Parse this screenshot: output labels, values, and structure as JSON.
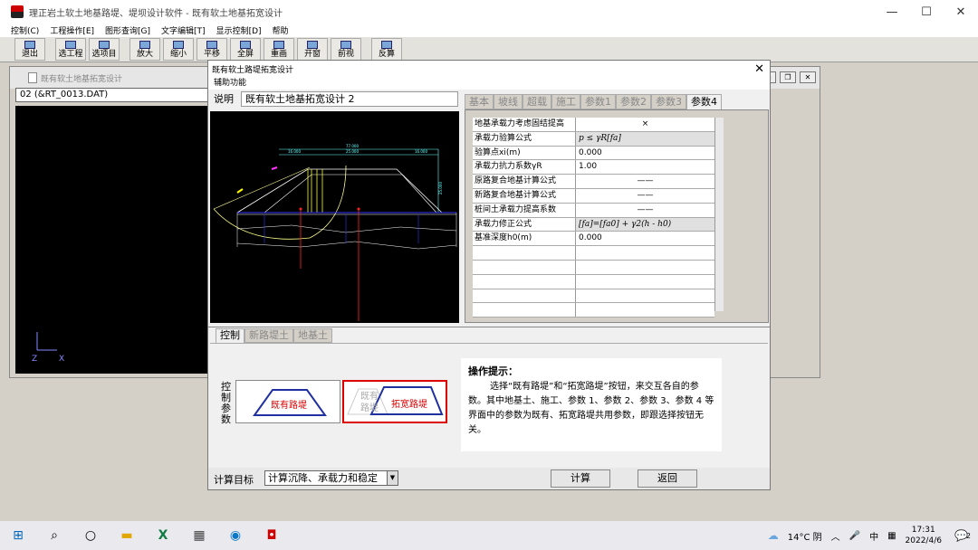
{
  "app": {
    "title": "理正岩土软土地基路堤、堤坝设计软件 - 既有软土地基拓宽设计",
    "window_controls": [
      "—",
      "☐",
      "✕"
    ]
  },
  "menu": [
    "控制(C)",
    "工程操作[E]",
    "图形查询[G]",
    "文字编辑[T]",
    "显示控制[D]",
    "帮助"
  ],
  "toolbar": [
    "退出",
    "选工程",
    "选项目",
    "放大",
    "缩小",
    "平移",
    "全屏",
    "重画",
    "开窗",
    "前视",
    "反算"
  ],
  "child": {
    "title": "既有软土地基拓宽设计",
    "file": "02 (&RT_0013.DAT)",
    "axis_z": "Z",
    "axis_x": "X"
  },
  "dialog": {
    "title": "既有软土路堤拓宽设计",
    "menu": "辅助功能",
    "close": "✕",
    "desc_label": "说明",
    "desc_value": "既有软土地基拓宽设计 2",
    "tabs_top": [
      "基本",
      "坡线",
      "超载",
      "施工",
      "参数1",
      "参数2",
      "参数3",
      "参数4"
    ],
    "active_tab": "参数4",
    "params": [
      {
        "name": "地基承载力考虑固结提高",
        "value": "×"
      },
      {
        "name": "承载力验算公式",
        "value": "p ≤ γR[fa]"
      },
      {
        "name": "验算点xi(m)",
        "value": "0.000"
      },
      {
        "name": "承载力抗力系数γR",
        "value": "1.00"
      },
      {
        "name": "原路复合地基计算公式",
        "value": "——"
      },
      {
        "name": "新路复合地基计算公式",
        "value": "——"
      },
      {
        "name": "桩间土承载力提高系数",
        "value": "——"
      },
      {
        "name": "承载力修正公式",
        "value": "[fa]=[fa0] + γ2(h - h0)"
      },
      {
        "name": "基准深度h0(m)",
        "value": "0.000"
      }
    ],
    "tabs_bottom": [
      "控制",
      "新路堤土",
      "地基土"
    ],
    "ctrl_label": "控制参数",
    "btn_existing": "既有路堤",
    "btn_widen": "拓宽路堤",
    "btn_widen_ghost": "既有路堤",
    "tip_title": "操作提示：",
    "tip_body": "选择“既有路堤”和“拓宽路堤”按钮，来交互各自的参数。其中地基土、施工、参数 1、参数 2、参数 3、参数 4 等界面中的参数为既有、拓宽路堤共用参数，即跟选择按钮无关。",
    "target_label": "计算目标",
    "target_value": "计算沉降、承载力和稳定",
    "btn_calc": "计算",
    "btn_back": "返回"
  },
  "cad_labels": [
    "77.000",
    "16.000",
    "25.000",
    "16.000",
    "25.000"
  ],
  "taskbar": {
    "weather": "14°C 阴",
    "ime": "中",
    "time": "17:31",
    "date": "2022/4/6",
    "notif": "2"
  }
}
